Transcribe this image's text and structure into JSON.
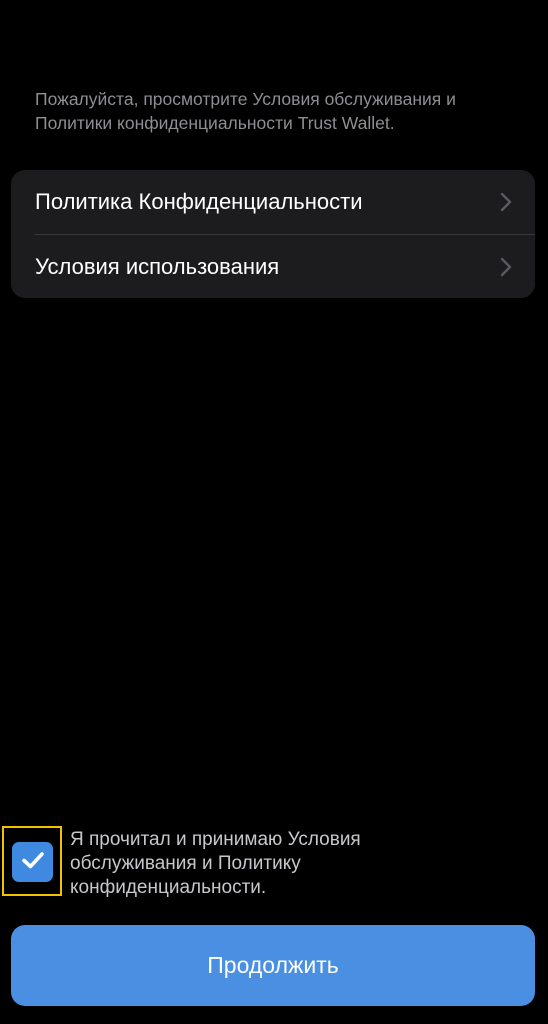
{
  "intro": {
    "text": "Пожалуйста, просмотрите Условия обслуживания и Политики конфиденциальности Trust Wallet."
  },
  "links": [
    {
      "label": "Политика Конфиденциальности",
      "icon": "chevron-right-icon"
    },
    {
      "label": "Условия использования",
      "icon": "chevron-right-icon"
    }
  ],
  "agreement": {
    "checked": true,
    "text": "Я прочитал и принимаю Условия обслуживания и Политику конфиденциальности.",
    "checkbox_color": "#3f8ae0",
    "highlight_color": "#f2c200"
  },
  "continue_button": {
    "label": "Продолжить",
    "color": "#4a8fe2"
  }
}
